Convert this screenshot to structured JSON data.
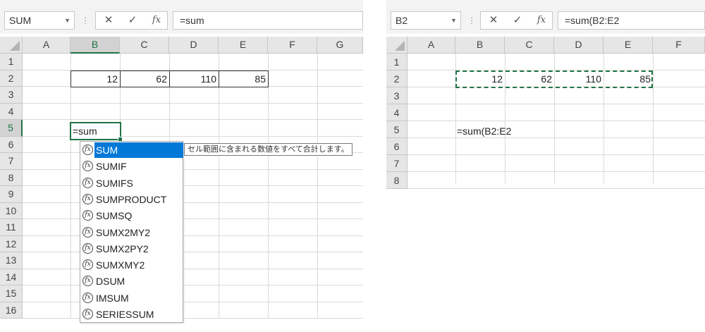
{
  "left_window": {
    "name_box": "SUM",
    "formula": "=sum",
    "columns": [
      "A",
      "B",
      "C",
      "D",
      "E",
      "F",
      "G"
    ],
    "selected_column": "B",
    "rows": [
      "1",
      "2",
      "3",
      "4",
      "5",
      "6",
      "7",
      "8",
      "9",
      "10",
      "11",
      "12",
      "13",
      "14",
      "15",
      "16"
    ],
    "selected_row": "5",
    "values": [
      "12",
      "62",
      "110",
      "85"
    ],
    "active_cell_text": "=sum",
    "autocomplete": [
      "SUM",
      "SUMIF",
      "SUMIFS",
      "SUMPRODUCT",
      "SUMSQ",
      "SUMX2MY2",
      "SUMX2PY2",
      "SUMXMY2",
      "DSUM",
      "IMSUM",
      "SERIESSUM"
    ],
    "tooltip": "セル範囲に含まれる数値をすべて合計します。"
  },
  "right_window": {
    "name_box": "B2",
    "formula": "=sum(B2:E2",
    "columns": [
      "A",
      "B",
      "C",
      "D",
      "E",
      "F"
    ],
    "rows": [
      "1",
      "2",
      "3",
      "4",
      "5",
      "6",
      "7",
      "8"
    ],
    "values": [
      "12",
      "62",
      "110",
      "85"
    ],
    "cell_b5_text": "=sum(B2:E2"
  },
  "toolbar": {
    "cancel": "✕",
    "enter": "✓",
    "fx": "fx",
    "separator": "⋮",
    "dropdown": "▼"
  },
  "colors": {
    "accent": "#217346",
    "highlight": "#0078d7"
  }
}
